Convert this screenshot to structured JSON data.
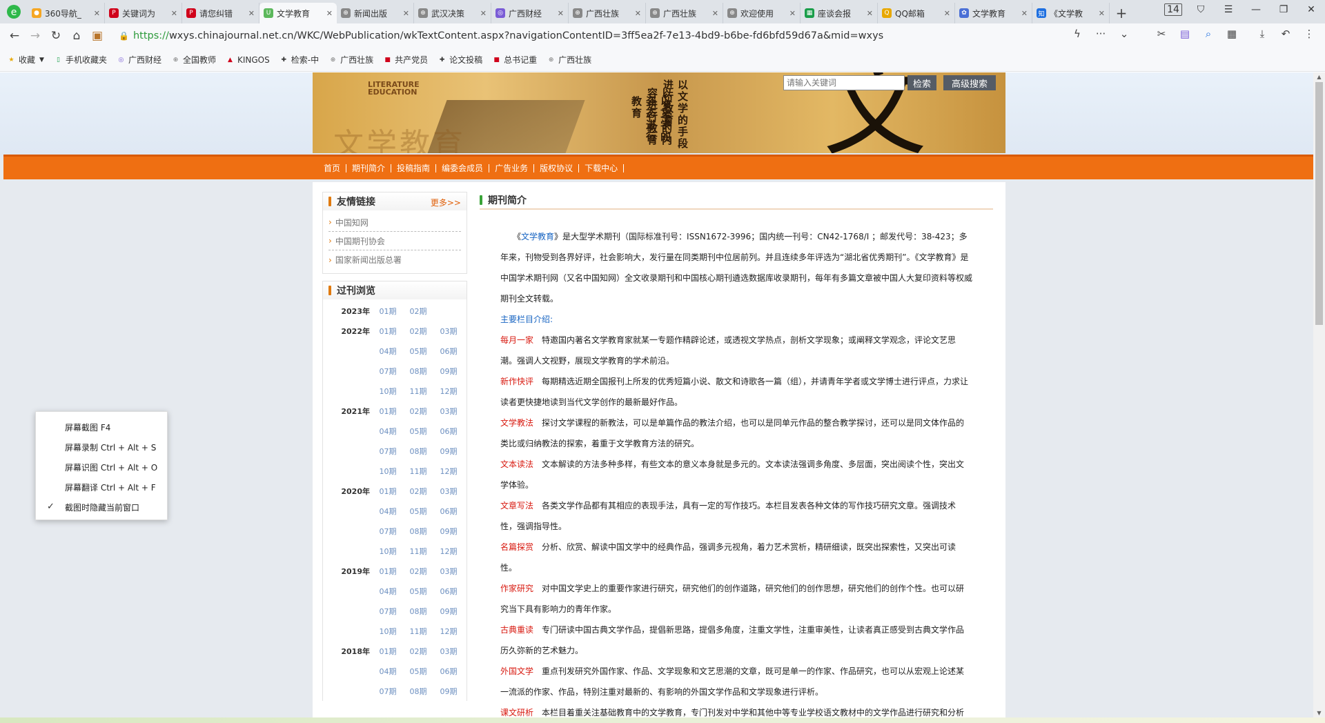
{
  "browser": {
    "tabs": [
      {
        "title": "360导航_",
        "fav_color": "#f5a623",
        "fav": "●"
      },
      {
        "title": "关键词为",
        "fav_color": "#d0021b",
        "fav": "P"
      },
      {
        "title": "请您纠错",
        "fav_color": "#d0021b",
        "fav": "P"
      },
      {
        "title": "文学教育",
        "fav_color": "#5cb85c",
        "fav": "U"
      },
      {
        "title": "新闻出版",
        "fav_color": "#888",
        "fav": "⊕"
      },
      {
        "title": "武汉决策",
        "fav_color": "#888",
        "fav": "⊕"
      },
      {
        "title": "广西财经",
        "fav_color": "#7a5cd6",
        "fav": "◎"
      },
      {
        "title": "广西壮族",
        "fav_color": "#888",
        "fav": "⊕"
      },
      {
        "title": "广西壮族",
        "fav_color": "#888",
        "fav": "⊕"
      },
      {
        "title": "欢迎使用",
        "fav_color": "#888",
        "fav": "⊕"
      },
      {
        "title": "座谈会报",
        "fav_color": "#1a9e4a",
        "fav": "▦"
      },
      {
        "title": "QQ邮箱",
        "fav_color": "#e8a800",
        "fav": "Q"
      },
      {
        "title": "文学教育",
        "fav_color": "#4a6fd6",
        "fav": "✿"
      },
      {
        "title": "《文学教",
        "fav_color": "#1e6fe0",
        "fav": "知"
      }
    ],
    "tab_count": "14",
    "url_proto": "https://",
    "url_rest": "wxys.chinajournal.net.cn/WKC/WebPublication/wkTextContent.aspx?navigationContentID=3ff5ea2f-7e13-4bd9-b6be-fd6bfd59d67a&mid=wxys",
    "bookmarks": [
      {
        "label": "收藏",
        "icon": "★",
        "color": "#e8a800"
      },
      {
        "label": "手机收藏夹",
        "icon": "▯",
        "color": "#1a9e4a"
      },
      {
        "label": "广西财经",
        "icon": "◎",
        "color": "#7a5cd6"
      },
      {
        "label": "全国教师",
        "icon": "⊕",
        "color": "#777"
      },
      {
        "label": "KINGOS",
        "icon": "▲",
        "color": "#d0021b"
      },
      {
        "label": "检索-中",
        "icon": "✚",
        "color": "#333"
      },
      {
        "label": "广西壮族",
        "icon": "⊕",
        "color": "#777"
      },
      {
        "label": "共产党员",
        "icon": "■",
        "color": "#d0021b"
      },
      {
        "label": "论文投稿",
        "icon": "✚",
        "color": "#333"
      },
      {
        "label": "总书记重",
        "icon": "■",
        "color": "#d0021b"
      },
      {
        "label": "广西壮族",
        "icon": "⊕",
        "color": "#777"
      }
    ]
  },
  "site": {
    "banner_en": "LITERATURE\nEDUCATION",
    "banner_vert1": "以文学的手段进行教育",
    "banner_vert2": "以文学的内容进行教育",
    "banner_vert3": "以文学的姿态进行教育",
    "banner_big": "文",
    "banner_watermark": "文学教育",
    "search_placeholder": "请输入关键词",
    "search_btn": "检索",
    "adv_search_btn": "高级搜索",
    "nav": [
      "首页",
      "期刊简介",
      "投稿指南",
      "编委会成员",
      "广告业务",
      "版权协议",
      "下载中心"
    ]
  },
  "friend_links": {
    "title": "友情链接",
    "more": "更多>>",
    "items": [
      "中国知网",
      "中国期刊协会",
      "国家新闻出版总署"
    ]
  },
  "archive": {
    "title": "过刊浏览",
    "rows": [
      {
        "year": "2023年",
        "issues": [
          "01期",
          "02期"
        ]
      },
      {
        "year": "2022年",
        "issues": [
          "01期",
          "02期",
          "03期"
        ]
      },
      {
        "year": "",
        "issues": [
          "04期",
          "05期",
          "06期"
        ]
      },
      {
        "year": "",
        "issues": [
          "07期",
          "08期",
          "09期"
        ]
      },
      {
        "year": "",
        "issues": [
          "10期",
          "11期",
          "12期"
        ]
      },
      {
        "year": "2021年",
        "issues": [
          "01期",
          "02期",
          "03期"
        ]
      },
      {
        "year": "",
        "issues": [
          "04期",
          "05期",
          "06期"
        ]
      },
      {
        "year": "",
        "issues": [
          "07期",
          "08期",
          "09期"
        ]
      },
      {
        "year": "",
        "issues": [
          "10期",
          "11期",
          "12期"
        ]
      },
      {
        "year": "2020年",
        "issues": [
          "01期",
          "02期",
          "03期"
        ]
      },
      {
        "year": "",
        "issues": [
          "04期",
          "05期",
          "06期"
        ]
      },
      {
        "year": "",
        "issues": [
          "07期",
          "08期",
          "09期"
        ]
      },
      {
        "year": "",
        "issues": [
          "10期",
          "11期",
          "12期"
        ]
      },
      {
        "year": "2019年",
        "issues": [
          "01期",
          "02期",
          "03期"
        ]
      },
      {
        "year": "",
        "issues": [
          "04期",
          "05期",
          "06期"
        ]
      },
      {
        "year": "",
        "issues": [
          "07期",
          "08期",
          "09期"
        ]
      },
      {
        "year": "",
        "issues": [
          "10期",
          "11期",
          "12期"
        ]
      },
      {
        "year": "2018年",
        "issues": [
          "01期",
          "02期",
          "03期"
        ]
      },
      {
        "year": "",
        "issues": [
          "04期",
          "05期",
          "06期"
        ]
      },
      {
        "year": "",
        "issues": [
          "07期",
          "08期",
          "09期"
        ]
      }
    ]
  },
  "article": {
    "title": "期刊简介",
    "intro_open": "《",
    "intro_link": "文学教育",
    "intro_text": "》是大型学术期刊（国际标准刊号：ISSN1672-3996；国内统一刊号：CN42-1768/I ；邮发代号：38-423；多年来，刊物受到各界好评，社会影响大，发行量在同类期刊中位居前列。并且连续多年评选为“湖北省优秀期刊”。《文学教育》是中国学术期刊网（又名中国知网）全文收录期刊和中国核心期刊遴选数据库收录期刊，每年有多篇文章被中国人大复印资料等权威期刊全文转载。",
    "section_header": "主要栏目介绍:",
    "sections": [
      {
        "name": "每月一家",
        "text": "特邀国内著名文学教育家就某一专题作精辟论述，或透视文学热点，剖析文学现象；或阐释文学观念，评论文艺思潮。强调人文视野，展现文学教育的学术前沿。"
      },
      {
        "name": "新作快评",
        "text": "每期精选近期全国报刊上所发的优秀短篇小说、散文和诗歌各一篇（组），并请青年学者或文学博士进行评点，力求让读者更快捷地读到当代文学创作的最新最好作品。"
      },
      {
        "name": "文学教法",
        "text": "探讨文学课程的新教法，可以是单篇作品的教法介绍，也可以是同单元作品的整合教学探讨，还可以是同文体作品的类比或归纳教法的探索，着重于文学教育方法的研究。"
      },
      {
        "name": "文本读法",
        "text": "文本解读的方法多种多样，有些文本的意义本身就是多元的。文本读法强调多角度、多层面，突出阅读个性，突出文学体验。"
      },
      {
        "name": "文章写法",
        "text": "各类文学作品都有其相应的表现手法，具有一定的写作技巧。本栏目发表各种文体的写作技巧研究文章。强调技术性，强调指导性。"
      },
      {
        "name": "名篇探赏",
        "text": "分析、欣赏、解读中国文学中的经典作品，强调多元视角，着力艺术赏析，精研细读，既突出探索性，又突出可读性。"
      },
      {
        "name": "作家研究",
        "text": "对中国文学史上的重要作家进行研究，研究他们的创作道路，研究他们的创作思想，研究他们的创作个性。也可以研究当下具有影响力的青年作家。"
      },
      {
        "name": "古典重读",
        "text": "专门研读中国古典文学作品，提倡新思路，提倡多角度，注重文学性，注重审美性，让读者真正感受到古典文学作品历久弥新的艺术魅力。"
      },
      {
        "name": "外国文学",
        "text": "重点刊发研究外国作家、作品、文学现象和文艺思潮的文章，既可是单一的作家、作品研究，也可以从宏观上论述某一流派的作家、作品，特别注重对最新的、有影响的外国文学作品和文学现象进行评析。"
      },
      {
        "name": "课文研析",
        "text": "本栏目着重关注基础教育中的文学教育，专门刊发对中学和其他中等专业学校语文教材中的文学作品进行研究和分析的"
      }
    ]
  },
  "context_menu": {
    "items": [
      "屏幕截图 F4",
      "屏幕录制 Ctrl + Alt + S",
      "屏幕识图 Ctrl + Alt + O",
      "屏幕翻译 Ctrl + Alt + F",
      "截图时隐藏当前窗口"
    ],
    "checked_index": 4
  }
}
